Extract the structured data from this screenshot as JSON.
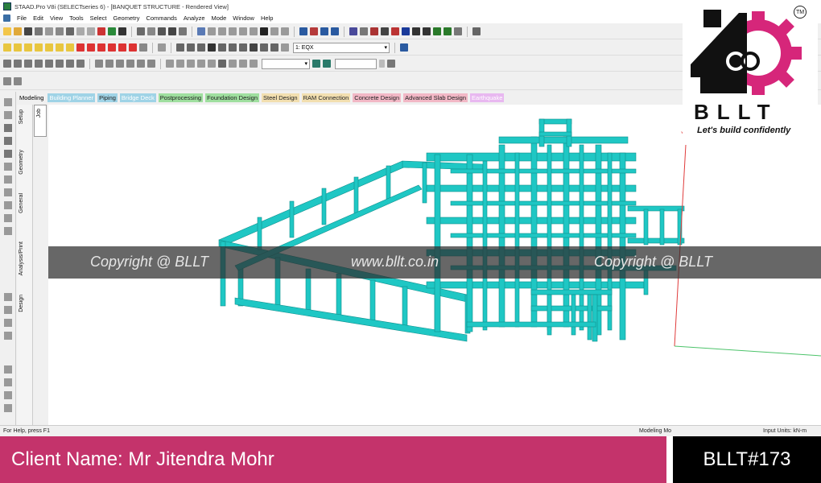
{
  "window": {
    "title": "STAAD.Pro V8i (SELECTseries 6) - [BANQUET STRUCTURE - Rendered View]"
  },
  "menu": [
    "File",
    "Edit",
    "View",
    "Tools",
    "Select",
    "Geometry",
    "Commands",
    "Analyze",
    "Mode",
    "Window",
    "Help"
  ],
  "toolbar": {
    "load_case_value": "1: EQX"
  },
  "workflow_tabs": [
    {
      "label": "Modeling",
      "color": "#ffffff"
    },
    {
      "label": "Building Planner",
      "color": "#9fd3e6"
    },
    {
      "label": "Piping",
      "color": "#9fd3e6"
    },
    {
      "label": "Bridge Deck",
      "color": "#9fd3e6"
    },
    {
      "label": "Postprocessing",
      "color": "#9fdf9f"
    },
    {
      "label": "Foundation Design",
      "color": "#9fdf9f"
    },
    {
      "label": "Steel Design",
      "color": "#f2dfb0"
    },
    {
      "label": "RAM Connection",
      "color": "#f2dfb0"
    },
    {
      "label": "Concrete Design",
      "color": "#f2b8c6"
    },
    {
      "label": "Advanced Slab Design",
      "color": "#f2b8c6"
    },
    {
      "label": "Earthquake",
      "color": "#e8b8f0"
    }
  ],
  "side_tabs": {
    "setup": "Setup",
    "geometry": "Geometry",
    "general": "General",
    "analysis_print": "Analysis/Print",
    "design": "Design",
    "job": "Job"
  },
  "viewport": {
    "axis_label": "Y",
    "model_color": "#1fc7c4"
  },
  "watermark": {
    "left": "Copyright @ BLLT",
    "center": "www.bllt.co.in",
    "right": "Copyright @ BLLT"
  },
  "status": {
    "help": "For Help, press F1",
    "mode": "Modeling Mo",
    "units": "Input Units:  kN-m"
  },
  "logo": {
    "word": "BLLT",
    "tagline": "Let's build confidently",
    "trademark": "TM"
  },
  "footer": {
    "client": "Client Name: Mr Jitendra Mohr",
    "code": "BLLT#173"
  },
  "colors": {
    "footer_magenta": "#c4336b",
    "footer_black": "#000000",
    "logo_gear": "#d6267a"
  }
}
